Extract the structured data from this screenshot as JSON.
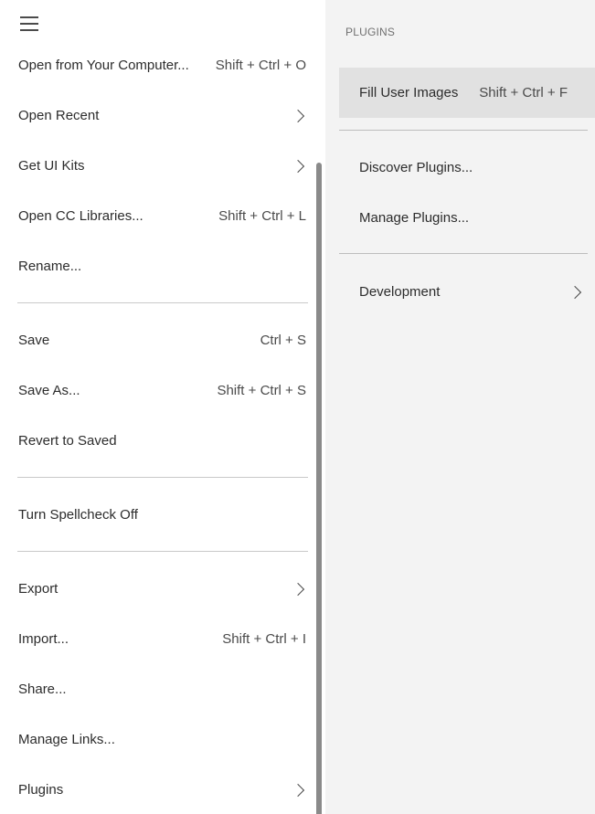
{
  "main_menu": {
    "items": [
      {
        "label": "Open from Your Computer...",
        "shortcut": "Shift + Ctrl + O"
      },
      {
        "label": "Open Recent",
        "shortcut": ""
      },
      {
        "label": "Get UI Kits",
        "shortcut": ""
      },
      {
        "label": "Open CC Libraries...",
        "shortcut": "Shift + Ctrl + L"
      },
      {
        "label": "Rename...",
        "shortcut": ""
      },
      {
        "label": "Save",
        "shortcut": "Ctrl + S"
      },
      {
        "label": "Save As...",
        "shortcut": "Shift + Ctrl + S"
      },
      {
        "label": "Revert to Saved",
        "shortcut": ""
      },
      {
        "label": "Turn Spellcheck Off",
        "shortcut": ""
      },
      {
        "label": "Export",
        "shortcut": ""
      },
      {
        "label": "Import...",
        "shortcut": "Shift + Ctrl + I"
      },
      {
        "label": "Share...",
        "shortcut": ""
      },
      {
        "label": "Manage Links...",
        "shortcut": ""
      },
      {
        "label": "Plugins",
        "shortcut": ""
      }
    ]
  },
  "plugins_submenu": {
    "header": "PLUGINS",
    "items": [
      {
        "label": "Fill User Images",
        "shortcut": "Shift + Ctrl + F"
      },
      {
        "label": "Discover Plugins...",
        "shortcut": ""
      },
      {
        "label": "Manage Plugins...",
        "shortcut": ""
      },
      {
        "label": "Development",
        "shortcut": ""
      }
    ]
  },
  "colors": {
    "menu_background": "#ffffff",
    "submenu_background": "#f3f3f3",
    "selected_background": "#e1e1e1",
    "accent": "#e34850"
  },
  "icons": [
    "hamburger-menu-icon",
    "chevron-right-icon"
  ]
}
